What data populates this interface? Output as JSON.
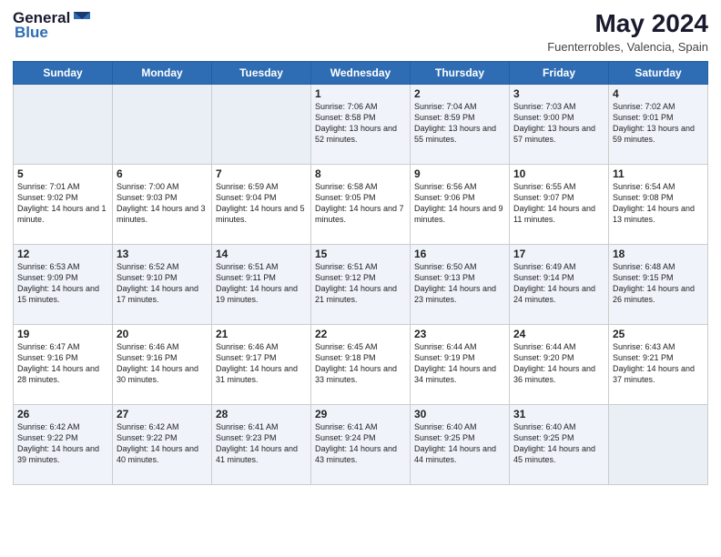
{
  "header": {
    "logo_line1": "General",
    "logo_line2": "Blue",
    "month_year": "May 2024",
    "location": "Fuenterrobles, Valencia, Spain"
  },
  "days_of_week": [
    "Sunday",
    "Monday",
    "Tuesday",
    "Wednesday",
    "Thursday",
    "Friday",
    "Saturday"
  ],
  "weeks": [
    [
      {
        "day": "",
        "sunrise": "",
        "sunset": "",
        "daylight": "",
        "empty": true
      },
      {
        "day": "",
        "sunrise": "",
        "sunset": "",
        "daylight": "",
        "empty": true
      },
      {
        "day": "",
        "sunrise": "",
        "sunset": "",
        "daylight": "",
        "empty": true
      },
      {
        "day": "1",
        "sunrise": "Sunrise: 7:06 AM",
        "sunset": "Sunset: 8:58 PM",
        "daylight": "Daylight: 13 hours and 52 minutes."
      },
      {
        "day": "2",
        "sunrise": "Sunrise: 7:04 AM",
        "sunset": "Sunset: 8:59 PM",
        "daylight": "Daylight: 13 hours and 55 minutes."
      },
      {
        "day": "3",
        "sunrise": "Sunrise: 7:03 AM",
        "sunset": "Sunset: 9:00 PM",
        "daylight": "Daylight: 13 hours and 57 minutes."
      },
      {
        "day": "4",
        "sunrise": "Sunrise: 7:02 AM",
        "sunset": "Sunset: 9:01 PM",
        "daylight": "Daylight: 13 hours and 59 minutes."
      }
    ],
    [
      {
        "day": "5",
        "sunrise": "Sunrise: 7:01 AM",
        "sunset": "Sunset: 9:02 PM",
        "daylight": "Daylight: 14 hours and 1 minute."
      },
      {
        "day": "6",
        "sunrise": "Sunrise: 7:00 AM",
        "sunset": "Sunset: 9:03 PM",
        "daylight": "Daylight: 14 hours and 3 minutes."
      },
      {
        "day": "7",
        "sunrise": "Sunrise: 6:59 AM",
        "sunset": "Sunset: 9:04 PM",
        "daylight": "Daylight: 14 hours and 5 minutes."
      },
      {
        "day": "8",
        "sunrise": "Sunrise: 6:58 AM",
        "sunset": "Sunset: 9:05 PM",
        "daylight": "Daylight: 14 hours and 7 minutes."
      },
      {
        "day": "9",
        "sunrise": "Sunrise: 6:56 AM",
        "sunset": "Sunset: 9:06 PM",
        "daylight": "Daylight: 14 hours and 9 minutes."
      },
      {
        "day": "10",
        "sunrise": "Sunrise: 6:55 AM",
        "sunset": "Sunset: 9:07 PM",
        "daylight": "Daylight: 14 hours and 11 minutes."
      },
      {
        "day": "11",
        "sunrise": "Sunrise: 6:54 AM",
        "sunset": "Sunset: 9:08 PM",
        "daylight": "Daylight: 14 hours and 13 minutes."
      }
    ],
    [
      {
        "day": "12",
        "sunrise": "Sunrise: 6:53 AM",
        "sunset": "Sunset: 9:09 PM",
        "daylight": "Daylight: 14 hours and 15 minutes."
      },
      {
        "day": "13",
        "sunrise": "Sunrise: 6:52 AM",
        "sunset": "Sunset: 9:10 PM",
        "daylight": "Daylight: 14 hours and 17 minutes."
      },
      {
        "day": "14",
        "sunrise": "Sunrise: 6:51 AM",
        "sunset": "Sunset: 9:11 PM",
        "daylight": "Daylight: 14 hours and 19 minutes."
      },
      {
        "day": "15",
        "sunrise": "Sunrise: 6:51 AM",
        "sunset": "Sunset: 9:12 PM",
        "daylight": "Daylight: 14 hours and 21 minutes."
      },
      {
        "day": "16",
        "sunrise": "Sunrise: 6:50 AM",
        "sunset": "Sunset: 9:13 PM",
        "daylight": "Daylight: 14 hours and 23 minutes."
      },
      {
        "day": "17",
        "sunrise": "Sunrise: 6:49 AM",
        "sunset": "Sunset: 9:14 PM",
        "daylight": "Daylight: 14 hours and 24 minutes."
      },
      {
        "day": "18",
        "sunrise": "Sunrise: 6:48 AM",
        "sunset": "Sunset: 9:15 PM",
        "daylight": "Daylight: 14 hours and 26 minutes."
      }
    ],
    [
      {
        "day": "19",
        "sunrise": "Sunrise: 6:47 AM",
        "sunset": "Sunset: 9:16 PM",
        "daylight": "Daylight: 14 hours and 28 minutes."
      },
      {
        "day": "20",
        "sunrise": "Sunrise: 6:46 AM",
        "sunset": "Sunset: 9:16 PM",
        "daylight": "Daylight: 14 hours and 30 minutes."
      },
      {
        "day": "21",
        "sunrise": "Sunrise: 6:46 AM",
        "sunset": "Sunset: 9:17 PM",
        "daylight": "Daylight: 14 hours and 31 minutes."
      },
      {
        "day": "22",
        "sunrise": "Sunrise: 6:45 AM",
        "sunset": "Sunset: 9:18 PM",
        "daylight": "Daylight: 14 hours and 33 minutes."
      },
      {
        "day": "23",
        "sunrise": "Sunrise: 6:44 AM",
        "sunset": "Sunset: 9:19 PM",
        "daylight": "Daylight: 14 hours and 34 minutes."
      },
      {
        "day": "24",
        "sunrise": "Sunrise: 6:44 AM",
        "sunset": "Sunset: 9:20 PM",
        "daylight": "Daylight: 14 hours and 36 minutes."
      },
      {
        "day": "25",
        "sunrise": "Sunrise: 6:43 AM",
        "sunset": "Sunset: 9:21 PM",
        "daylight": "Daylight: 14 hours and 37 minutes."
      }
    ],
    [
      {
        "day": "26",
        "sunrise": "Sunrise: 6:42 AM",
        "sunset": "Sunset: 9:22 PM",
        "daylight": "Daylight: 14 hours and 39 minutes."
      },
      {
        "day": "27",
        "sunrise": "Sunrise: 6:42 AM",
        "sunset": "Sunset: 9:22 PM",
        "daylight": "Daylight: 14 hours and 40 minutes."
      },
      {
        "day": "28",
        "sunrise": "Sunrise: 6:41 AM",
        "sunset": "Sunset: 9:23 PM",
        "daylight": "Daylight: 14 hours and 41 minutes."
      },
      {
        "day": "29",
        "sunrise": "Sunrise: 6:41 AM",
        "sunset": "Sunset: 9:24 PM",
        "daylight": "Daylight: 14 hours and 43 minutes."
      },
      {
        "day": "30",
        "sunrise": "Sunrise: 6:40 AM",
        "sunset": "Sunset: 9:25 PM",
        "daylight": "Daylight: 14 hours and 44 minutes."
      },
      {
        "day": "31",
        "sunrise": "Sunrise: 6:40 AM",
        "sunset": "Sunset: 9:25 PM",
        "daylight": "Daylight: 14 hours and 45 minutes."
      },
      {
        "day": "",
        "sunrise": "",
        "sunset": "",
        "daylight": "",
        "empty": true
      }
    ]
  ]
}
